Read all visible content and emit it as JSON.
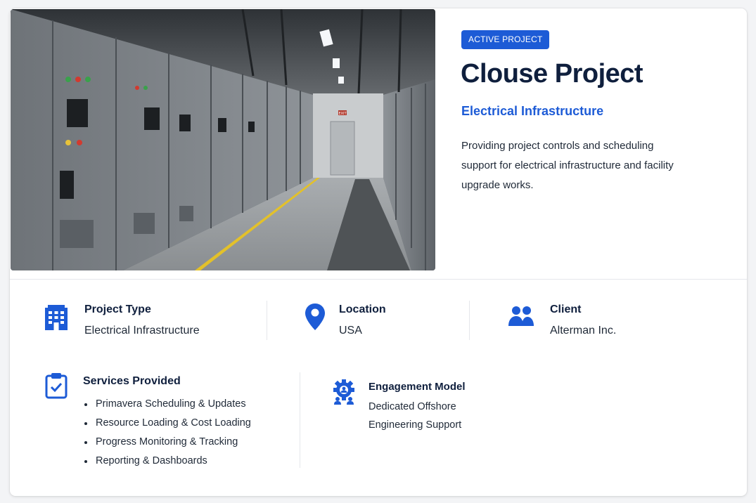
{
  "hero": {
    "image_subject": "electrical switchgear room corridor",
    "exit_sign": "EXIT"
  },
  "project": {
    "badge": "ACTIVE PROJECT",
    "title": "Clouse Project",
    "subtitle": "Electrical Infrastructure",
    "description": "Providing project controls and scheduling support for electrical infrastructure and facility upgrade works."
  },
  "info": {
    "project_type": {
      "label": "Project Type",
      "value": "Electrical Infrastructure",
      "icon": "building-icon"
    },
    "location": {
      "label": "Location",
      "value": "USA",
      "icon": "map-pin-icon"
    },
    "client": {
      "label": "Client",
      "value": "Alterman Inc.",
      "icon": "users-icon"
    }
  },
  "services": {
    "label": "Services Provided",
    "icon": "clipboard-check-icon",
    "items": [
      "Primavera Scheduling & Updates",
      "Resource Loading & Cost Loading",
      "Progress Monitoring & Tracking",
      "Reporting & Dashboards"
    ]
  },
  "engagement": {
    "label": "Engagement Model",
    "icon": "gear-team-icon",
    "value": "Dedicated Offshore Engineering Support"
  },
  "colors": {
    "accent": "#1d5bd6",
    "heading": "#0f1f3d",
    "body_text": "#1f2937",
    "divider": "#e5e7eb"
  }
}
